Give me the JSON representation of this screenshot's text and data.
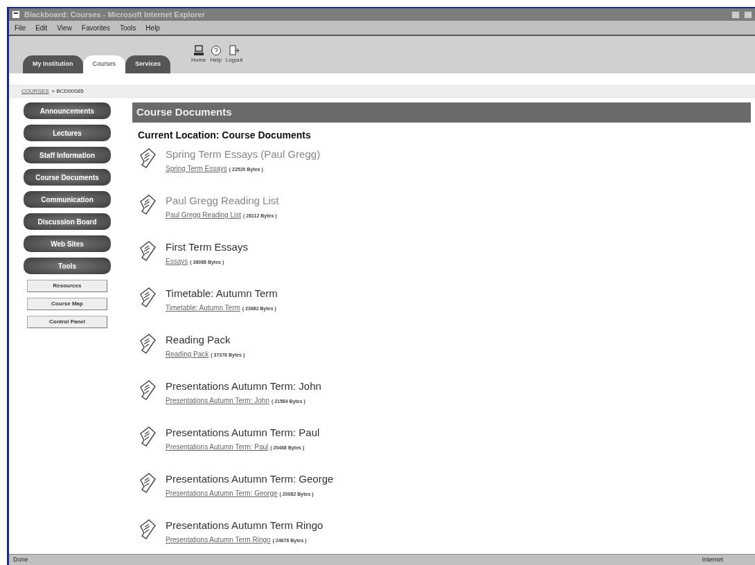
{
  "window": {
    "title": "Blackboard: Courses - Microsoft Internet Explorer"
  },
  "menu": [
    "File",
    "Edit",
    "View",
    "Favorites",
    "Tools",
    "Help"
  ],
  "tabs": [
    {
      "label": "My Institution",
      "selected": false
    },
    {
      "label": "Courses",
      "selected": true
    },
    {
      "label": "Services",
      "selected": false
    }
  ],
  "toolbar": [
    {
      "kind": "home",
      "label": "Home"
    },
    {
      "kind": "help",
      "label": "Help"
    },
    {
      "kind": "logout",
      "label": "Logout"
    }
  ],
  "breadcrumb": {
    "link": "COURSES",
    "current": "> BCD00085"
  },
  "sidebar": {
    "items": [
      "Announcements",
      "Lectures",
      "Staff Information",
      "Course Documents",
      "Communication",
      "Discussion Board",
      "Web Sites",
      "Tools"
    ],
    "tools": [
      "Resources",
      "Course Map",
      "Control Panel"
    ]
  },
  "section_title": "Course Documents",
  "location": "Current Location: Course Documents",
  "documents": [
    {
      "title": "Spring Term Essays (Paul Gregg)",
      "link": "Spring Term Essays",
      "size": "( 22520 Bytes )",
      "faded": true
    },
    {
      "title": "Paul Gregg Reading List",
      "link": "Paul Gregg Reading List",
      "size": "( 28112 Bytes )",
      "faded": true
    },
    {
      "title": "First Term Essays",
      "link": "Essays",
      "size": "( 38088 Bytes )",
      "faded": false
    },
    {
      "title": "Timetable: Autumn Term",
      "link": "Timetable: Autumn Term",
      "size": "( 23682 Bytes )",
      "faded": false
    },
    {
      "title": "Reading Pack",
      "link": "Reading Pack",
      "size": "( 37378 Bytes )",
      "faded": false
    },
    {
      "title": "Presentations Autumn Term: John",
      "link": "Presentations Autumn Term: John",
      "size": "( 21584 Bytes )",
      "faded": false
    },
    {
      "title": "Presentations Autumn Term: Paul",
      "link": "Presentations Autumn Term: Paul",
      "size": "( 20468 Bytes )",
      "faded": false
    },
    {
      "title": "Presentations Autumn Term: George",
      "link": "Presentations Autumn Term: George",
      "size": "( 20082 Bytes )",
      "faded": false
    },
    {
      "title": "Presentations Autumn Term Ringo",
      "link": "Presentations Autumn Term Ringo",
      "size": "( 24676 Bytes )",
      "faded": false
    }
  ],
  "status_bar": {
    "text": "Done",
    "zone": "Internet"
  }
}
